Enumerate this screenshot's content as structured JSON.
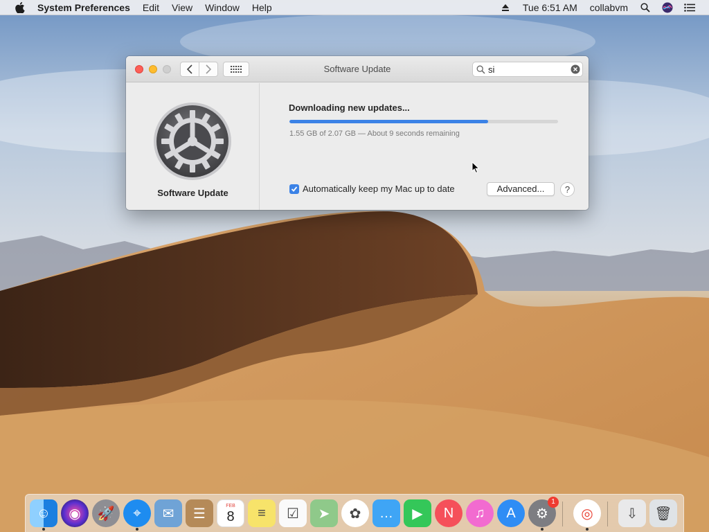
{
  "menubar": {
    "app_name": "System Preferences",
    "menus": [
      "Edit",
      "View",
      "Window",
      "Help"
    ],
    "clock": "Tue 6:51 AM",
    "user": "collabvm"
  },
  "window": {
    "title": "Software Update",
    "search": {
      "value": "si",
      "placeholder": "Search"
    },
    "pane_name": "Software Update",
    "status_title": "Downloading new updates...",
    "progress_fraction": 0.74,
    "progress_detail": "1.55 GB of 2.07 GB — About 9 seconds remaining",
    "auto_update_label": "Automatically keep my Mac up to date",
    "auto_update_checked": true,
    "advanced_button": "Advanced...",
    "help_button": "?"
  },
  "dock": {
    "items": [
      {
        "name": "Finder",
        "icon": "finder-icon",
        "color": "#3b9cf0",
        "running": true
      },
      {
        "name": "Siri",
        "icon": "siri-icon",
        "color": "#3a2b6e",
        "running": false
      },
      {
        "name": "Launchpad",
        "icon": "launchpad-icon",
        "color": "#8e8e93",
        "running": false
      },
      {
        "name": "Safari",
        "icon": "safari-icon",
        "color": "#1e8cf0",
        "running": true
      },
      {
        "name": "Mail",
        "icon": "mail-icon",
        "color": "#6fa3d6",
        "running": false
      },
      {
        "name": "Contacts",
        "icon": "contacts-icon",
        "color": "#b58a58",
        "running": false
      },
      {
        "name": "Calendar",
        "icon": "calendar-icon",
        "color": "#ffffff",
        "running": false,
        "month": "FEB",
        "day": "8"
      },
      {
        "name": "Notes",
        "icon": "notes-icon",
        "color": "#f7e36a",
        "running": false
      },
      {
        "name": "Reminders",
        "icon": "reminders-icon",
        "color": "#fafafa",
        "running": false
      },
      {
        "name": "Maps",
        "icon": "maps-icon",
        "color": "#8fc98a",
        "running": false
      },
      {
        "name": "Photos",
        "icon": "photos-icon",
        "color": "#ffffff",
        "running": false
      },
      {
        "name": "Messages",
        "icon": "messages-icon",
        "color": "#3fa5f5",
        "running": false
      },
      {
        "name": "FaceTime",
        "icon": "facetime-icon",
        "color": "#34c759",
        "running": false
      },
      {
        "name": "News",
        "icon": "news-icon",
        "color": "#f5505a",
        "running": false
      },
      {
        "name": "iTunes",
        "icon": "itunes-icon",
        "color": "#f26bd0",
        "running": false
      },
      {
        "name": "App Store",
        "icon": "app-store-icon",
        "color": "#2f8df5",
        "running": false
      },
      {
        "name": "System Preferences",
        "icon": "system-preferences-icon",
        "color": "#7d7d82",
        "running": true,
        "badge": "1"
      },
      {
        "name": "Google Chrome",
        "icon": "chrome-icon",
        "color": "#ffffff",
        "running": true
      },
      {
        "name": "Downloads",
        "icon": "downloads-stack-icon",
        "color": "#e9e9ea",
        "running": false
      },
      {
        "name": "Trash",
        "icon": "trash-icon",
        "color": "#dfe3e6",
        "running": false
      }
    ]
  }
}
